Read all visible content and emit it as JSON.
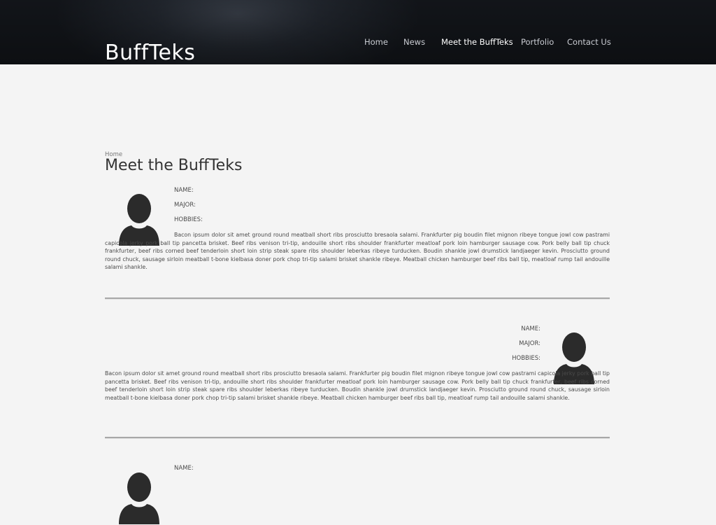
{
  "site": {
    "logo": "BuffTeks"
  },
  "nav": {
    "items": [
      {
        "label": "Home",
        "active": false
      },
      {
        "label": "News",
        "active": false
      },
      {
        "label": "Meet the BuffTeks",
        "active": true
      },
      {
        "label": "Portfolio",
        "active": false
      },
      {
        "label": "Contact Us",
        "active": false
      }
    ]
  },
  "breadcrumb": "Home",
  "page_title": "Meet the BuffTeks",
  "members": [
    {
      "name_label": "NAME:",
      "major_label": "MAJOR:",
      "hobbies_label": "HOBBIES:",
      "bio": "Bacon ipsum dolor sit amet ground round meatball short ribs prosciutto bresaola salami. Frankfurter pig boudin filet mignon ribeye tongue jowl cow pastrami capicola jerky pork ball tip pancetta brisket. Beef ribs venison tri-tip, andouille short ribs shoulder frankfurter meatloaf pork loin hamburger sausage cow. Pork belly ball tip chuck frankfurter, beef ribs corned beef tenderloin short loin strip steak spare ribs shoulder leberkas ribeye turducken. Boudin shankle jowl drumstick landjaeger kevin. Prosciutto ground round chuck, sausage sirloin meatball t-bone kielbasa doner pork chop tri-tip salami brisket shankle ribeye. Meatball chicken hamburger beef ribs ball tip, meatloaf rump tail andouille salami shankle."
    },
    {
      "name_label": "NAME:",
      "major_label": "MAJOR:",
      "hobbies_label": "HOBBIES:",
      "bio": "Bacon ipsum dolor sit amet ground round meatball short ribs prosciutto bresaola salami. Frankfurter pig boudin filet mignon ribeye tongue jowl cow pastrami capicola jerky pork ball tip pancetta brisket. Beef ribs venison tri-tip, andouille short ribs shoulder frankfurter meatloaf pork loin hamburger sausage cow. Pork belly ball tip chuck frankfurter, beef ribs corned beef tenderloin short loin strip steak spare ribs shoulder leberkas ribeye turducken. Boudin shankle jowl drumstick landjaeger kevin. Prosciutto ground round chuck, sausage sirloin meatball t-bone kielbasa doner pork chop tri-tip salami brisket shankle ribeye. Meatball chicken hamburger beef ribs ball tip, meatloaf rump tail andouille salami shankle."
    },
    {
      "name_label": "NAME:"
    }
  ],
  "icons": {
    "avatar": "person-silhouette-icon"
  },
  "colors": {
    "header_bg": "#14171c",
    "page_bg": "#f4f4f4",
    "avatar": "#2b2b2b"
  }
}
